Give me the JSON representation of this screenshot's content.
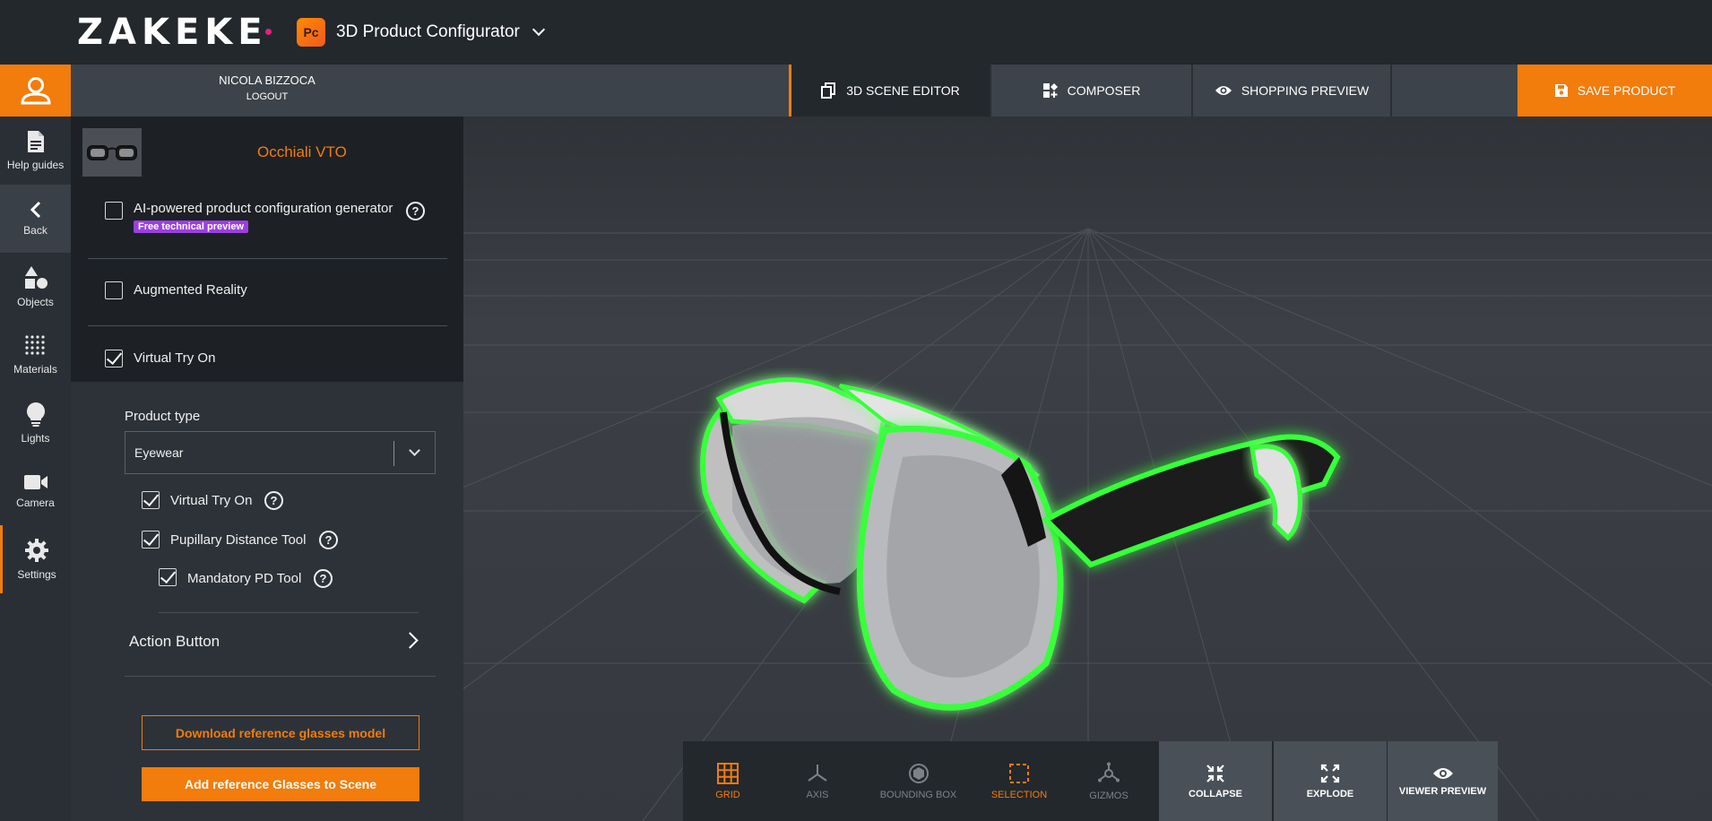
{
  "brand": {
    "logo_text": "ZAKEKE",
    "accent": "#f27c0c",
    "app_icon_text": "Pc",
    "app_name": "3D Product Configurator"
  },
  "user": {
    "name": "NICOLA BIZZOCA",
    "logout": "LOGOUT"
  },
  "rail": [
    {
      "label": "Help guides",
      "icon": "document-icon"
    },
    {
      "label": "Back",
      "icon": "chevron-left-icon"
    },
    {
      "label": "Objects",
      "icon": "shapes-icon"
    },
    {
      "label": "Materials",
      "icon": "dots-grid-icon"
    },
    {
      "label": "Lights",
      "icon": "bulb-icon"
    },
    {
      "label": "Camera",
      "icon": "camera-icon"
    },
    {
      "label": "Settings",
      "icon": "gear-icon"
    }
  ],
  "tabs": [
    {
      "label": "3D SCENE EDITOR",
      "active": true
    },
    {
      "label": "COMPOSER",
      "active": false
    },
    {
      "label": "SHOPPING PREVIEW",
      "active": false
    }
  ],
  "save_label": "SAVE PRODUCT",
  "product": {
    "name": "Occhiali VTO"
  },
  "options": {
    "ai": {
      "label": "AI-powered product configuration generator",
      "badge": "Free technical preview",
      "checked": false
    },
    "ar": {
      "label": "Augmented Reality",
      "checked": false
    },
    "vto": {
      "label": "Virtual Try On",
      "checked": true
    }
  },
  "product_type": {
    "label": "Product type",
    "value": "Eyewear"
  },
  "sub_options": {
    "vto": {
      "label": "Virtual Try On",
      "checked": true
    },
    "pd": {
      "label": "Pupillary Distance Tool",
      "checked": true
    },
    "mpd": {
      "label": "Mandatory PD Tool",
      "checked": true
    }
  },
  "action_button": "Action Button",
  "buttons": {
    "download": "Download reference glasses model",
    "add": "Add reference Glasses to Scene"
  },
  "toolbar": {
    "grid": "GRID",
    "axis": "AXIS",
    "bbox": "BOUNDING BOX",
    "selection": "SELECTION",
    "gizmos": "GIZMOS",
    "collapse": "COLLAPSE",
    "explode": "EXPLODE",
    "viewer_preview": "VIEWER PREVIEW"
  }
}
